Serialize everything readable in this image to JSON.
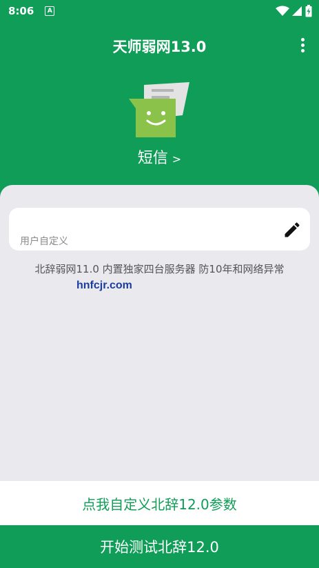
{
  "status_bar": {
    "time": "8:06",
    "notification_badge": "A"
  },
  "app_bar": {
    "title": "天师弱网13.0",
    "more_icon": "more-vert-icon"
  },
  "sms": {
    "label": "短信",
    "arrow": ">"
  },
  "input": {
    "placeholder": "用户自定义",
    "edit_icon": "edit-pencil-icon"
  },
  "description": "北辞弱网11.0 内置独家四台服务器 防10年和网络异常",
  "watermark": "hnfcjr.com",
  "buttons": {
    "customize_label": "点我自定义北辞12.0参数",
    "start_label": "开始测试北辞12.0"
  },
  "colors": {
    "primary_green": "#0f9d58",
    "background": "#e9e9ee",
    "sms_icon_green": "#8bc34a"
  }
}
